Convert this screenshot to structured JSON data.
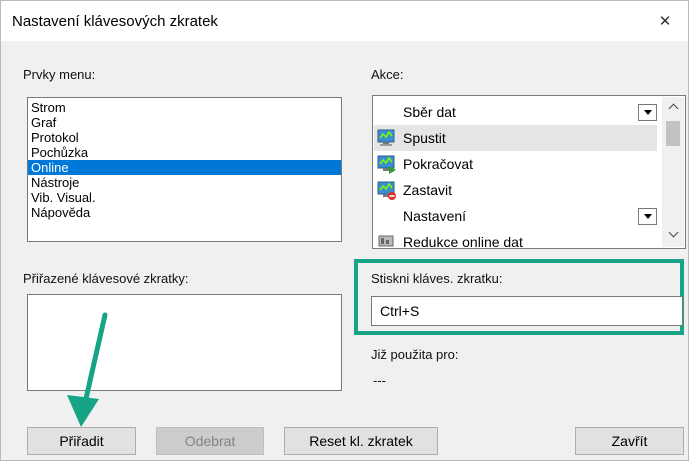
{
  "window": {
    "title": "Nastavení klávesových zkratek",
    "close_glyph": "✕"
  },
  "menu_items": {
    "label": "Prvky menu:",
    "items": [
      "Strom",
      "Graf",
      "Protokol",
      "Pochůzka",
      "Online",
      "Nástroje",
      "Vib. Visual.",
      "Nápověda"
    ],
    "selected": "Online"
  },
  "actions": {
    "label": "Akce:",
    "rows": [
      {
        "text": "Sběr dat",
        "icon": "none",
        "has_dropdown": true
      },
      {
        "text": "Spustit",
        "icon": "start-monitor-icon",
        "selected": true
      },
      {
        "text": "Pokračovat",
        "icon": "continue-monitor-icon"
      },
      {
        "text": "Zastavit",
        "icon": "stop-monitor-icon"
      },
      {
        "text": "Nastavení",
        "icon": "none",
        "has_dropdown": true
      },
      {
        "text": "Redukce online dat",
        "icon": "data-reduction-icon"
      }
    ]
  },
  "assigned": {
    "label": "Přiřazené klávesové zkratky:"
  },
  "press_shortcut": {
    "label": "Stiskni kláves. zkratku:",
    "value": "Ctrl+S"
  },
  "already_used": {
    "label": "Již použita pro:",
    "value": "---"
  },
  "buttons": {
    "assign": "Přiřadit",
    "remove": "Odebrat",
    "reset": "Reset kl. zkratek",
    "close": "Zavřít"
  },
  "colors": {
    "selection": "#0078d7",
    "highlight": "#16a386",
    "annotation_arrow": "#16a386"
  }
}
